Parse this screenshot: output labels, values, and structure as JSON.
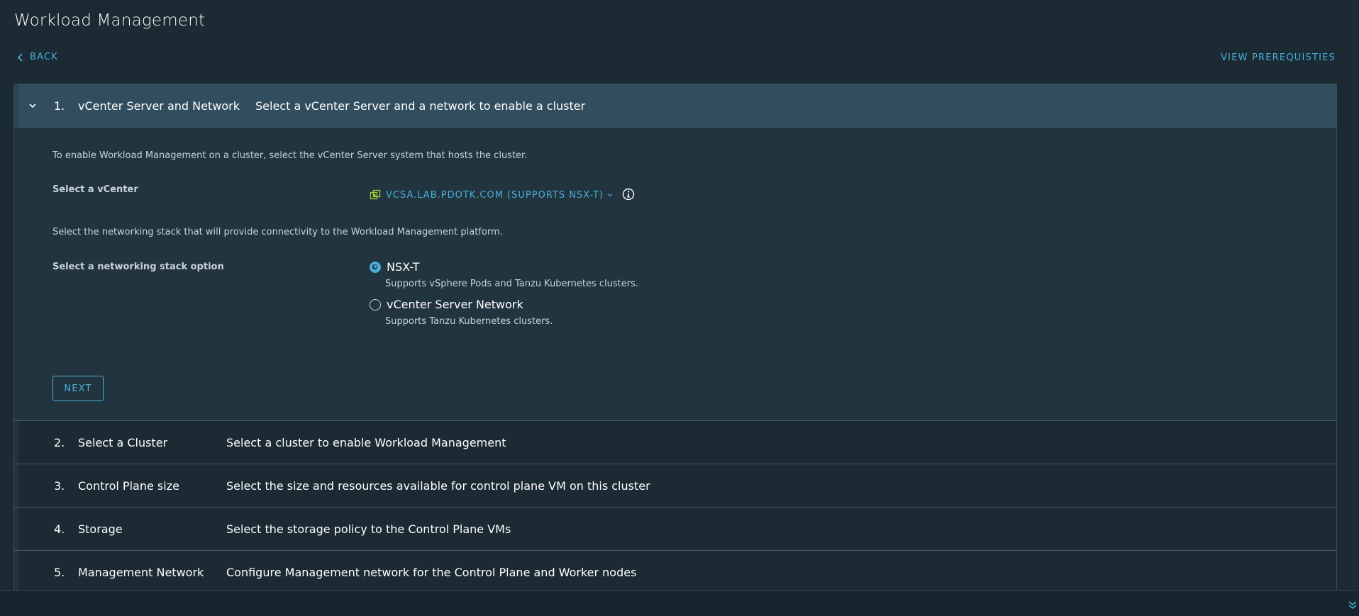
{
  "header": {
    "title": "Workload Management",
    "back_label": "BACK",
    "prereq_label": "VIEW PREREQUISTIES"
  },
  "steps": [
    {
      "number": "1.",
      "name": "vCenter Server and Network",
      "description": "Select a vCenter Server and a network to enable a cluster",
      "expanded": true
    },
    {
      "number": "2.",
      "name": "Select a Cluster",
      "description": "Select a cluster to enable Workload Management",
      "expanded": false
    },
    {
      "number": "3.",
      "name": "Control Plane size",
      "description": "Select the size and resources available for control plane VM on this cluster",
      "expanded": false
    },
    {
      "number": "4.",
      "name": "Storage",
      "description": "Select the storage policy to the Control Plane VMs",
      "expanded": false
    },
    {
      "number": "5.",
      "name": "Management Network",
      "description": "Configure Management network for the Control Plane and Worker nodes",
      "expanded": false
    }
  ],
  "step1": {
    "intro": "To enable Workload Management on a cluster, select the vCenter Server system that hosts the cluster.",
    "vcenter_label": "Select a vCenter",
    "vcenter_value": "VCSA.LAB.PDOTK.COM (SUPPORTS NSX-T)",
    "network_intro": "Select the networking stack that will provide connectivity to the Workload Management platform.",
    "network_label": "Select a networking stack option",
    "options": [
      {
        "label": "NSX-T",
        "sub": "Supports vSphere Pods and Tanzu Kubernetes clusters.",
        "selected": true
      },
      {
        "label": "vCenter Server Network",
        "sub": "Supports Tanzu Kubernetes clusters.",
        "selected": false
      }
    ],
    "next_label": "NEXT"
  },
  "colors": {
    "background": "#1b2a33",
    "accent": "#49afd9",
    "active_header": "#324e5e",
    "body": "#22343e",
    "vcenter_icon": "#9ed13b"
  },
  "icons": {
    "back": "chevron-left-icon",
    "step_toggle": "chevron-down-icon",
    "vcenter": "vcenter-icon",
    "info": "info-icon",
    "footer": "double-chevron-down-icon"
  }
}
